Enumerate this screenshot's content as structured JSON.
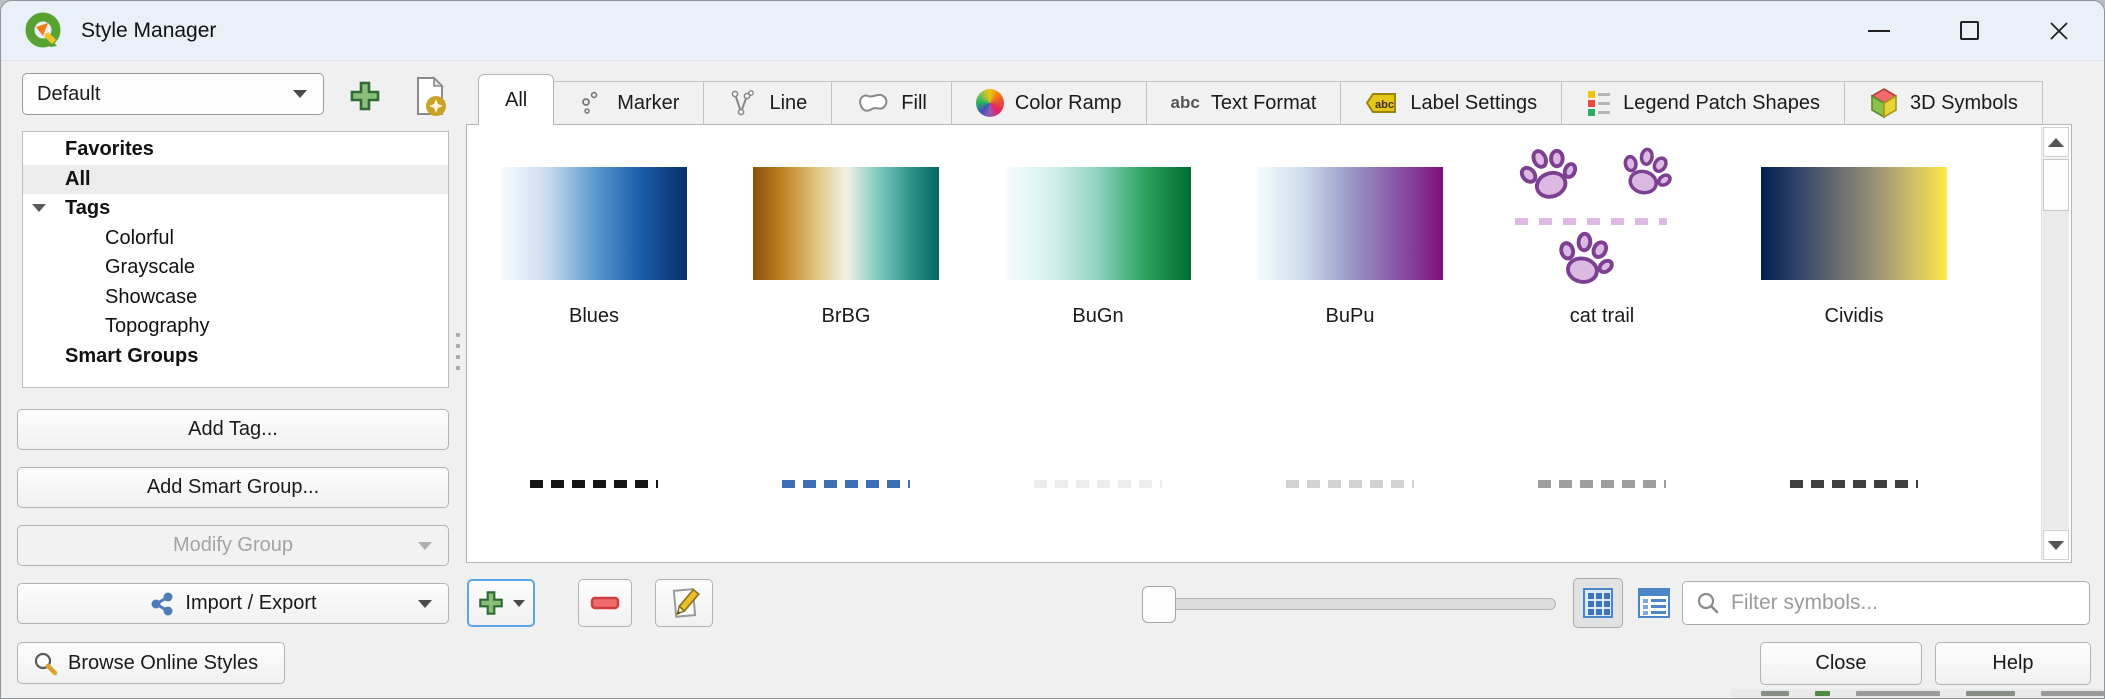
{
  "window": {
    "title": "Style Manager"
  },
  "profile": {
    "value": "Default"
  },
  "sidebar": {
    "tree": [
      {
        "label": "Favorites"
      },
      {
        "label": "All"
      },
      {
        "label": "Tags"
      },
      {
        "label": "Colorful"
      },
      {
        "label": "Grayscale"
      },
      {
        "label": "Showcase"
      },
      {
        "label": "Topography"
      },
      {
        "label": "Smart Groups"
      }
    ],
    "add_tag_label": "Add Tag...",
    "add_smart_group_label": "Add Smart Group...",
    "modify_group_label": "Modify Group",
    "import_export_label": "Import / Export",
    "browse_label": "Browse Online Styles"
  },
  "tabs": [
    {
      "label": "All",
      "icon": "none",
      "active": true
    },
    {
      "label": "Marker",
      "icon": "marker-dots-icon"
    },
    {
      "label": "Line",
      "icon": "line-vertices-icon"
    },
    {
      "label": "Fill",
      "icon": "fill-blob-icon"
    },
    {
      "label": "Color Ramp",
      "icon": "color-wheel-icon"
    },
    {
      "label": "Text Format",
      "icon": "abc-text-icon"
    },
    {
      "label": "Label Settings",
      "icon": "abc-tag-icon"
    },
    {
      "label": "Legend Patch Shapes",
      "icon": "legend-patch-icon"
    },
    {
      "label": "3D Symbols",
      "icon": "cube-3d-icon"
    }
  ],
  "gallery": {
    "ramps": [
      {
        "name": "Blues",
        "stops": [
          "#f7fbff",
          "#cbdcef",
          "#5b9bd0",
          "#1b5da8",
          "#08306b"
        ]
      },
      {
        "name": "BrBG",
        "stops": [
          "#8c510a",
          "#c08425",
          "#dfc27d",
          "#f5f1e4",
          "#80cdc1",
          "#35978f",
          "#01665e"
        ]
      },
      {
        "name": "BuGn",
        "stops": [
          "#f7fcfd",
          "#d5efee",
          "#8fd4c0",
          "#2ca25f",
          "#006d2c"
        ]
      },
      {
        "name": "BuPu",
        "stops": [
          "#f7fcfd",
          "#ccdcec",
          "#9a9ac8",
          "#8856a7",
          "#810f7c"
        ]
      },
      {
        "name": "cat trail",
        "paw_fill": "#dcb9e3",
        "paw_stroke": "#7c3f92",
        "trail_color": "#ddbbe4"
      },
      {
        "name": "Cividis",
        "stops": [
          "#00204d",
          "#31446b",
          "#666970",
          "#958f78",
          "#cbba69",
          "#ffea46"
        ]
      }
    ],
    "partial_row_dash_colors": [
      "#141414",
      "#3d6fb5",
      "#ececec",
      "#d2d2d2",
      "#9e9e9e",
      "#3f3f3f"
    ]
  },
  "bottom_bar": {
    "filter_placeholder": "Filter symbols..."
  },
  "footer": {
    "close_label": "Close",
    "help_label": "Help"
  },
  "colors": {
    "accent_focus": "#5ca6e8",
    "selection_row": "#ececec",
    "titlebar": "#eaf0f7"
  }
}
